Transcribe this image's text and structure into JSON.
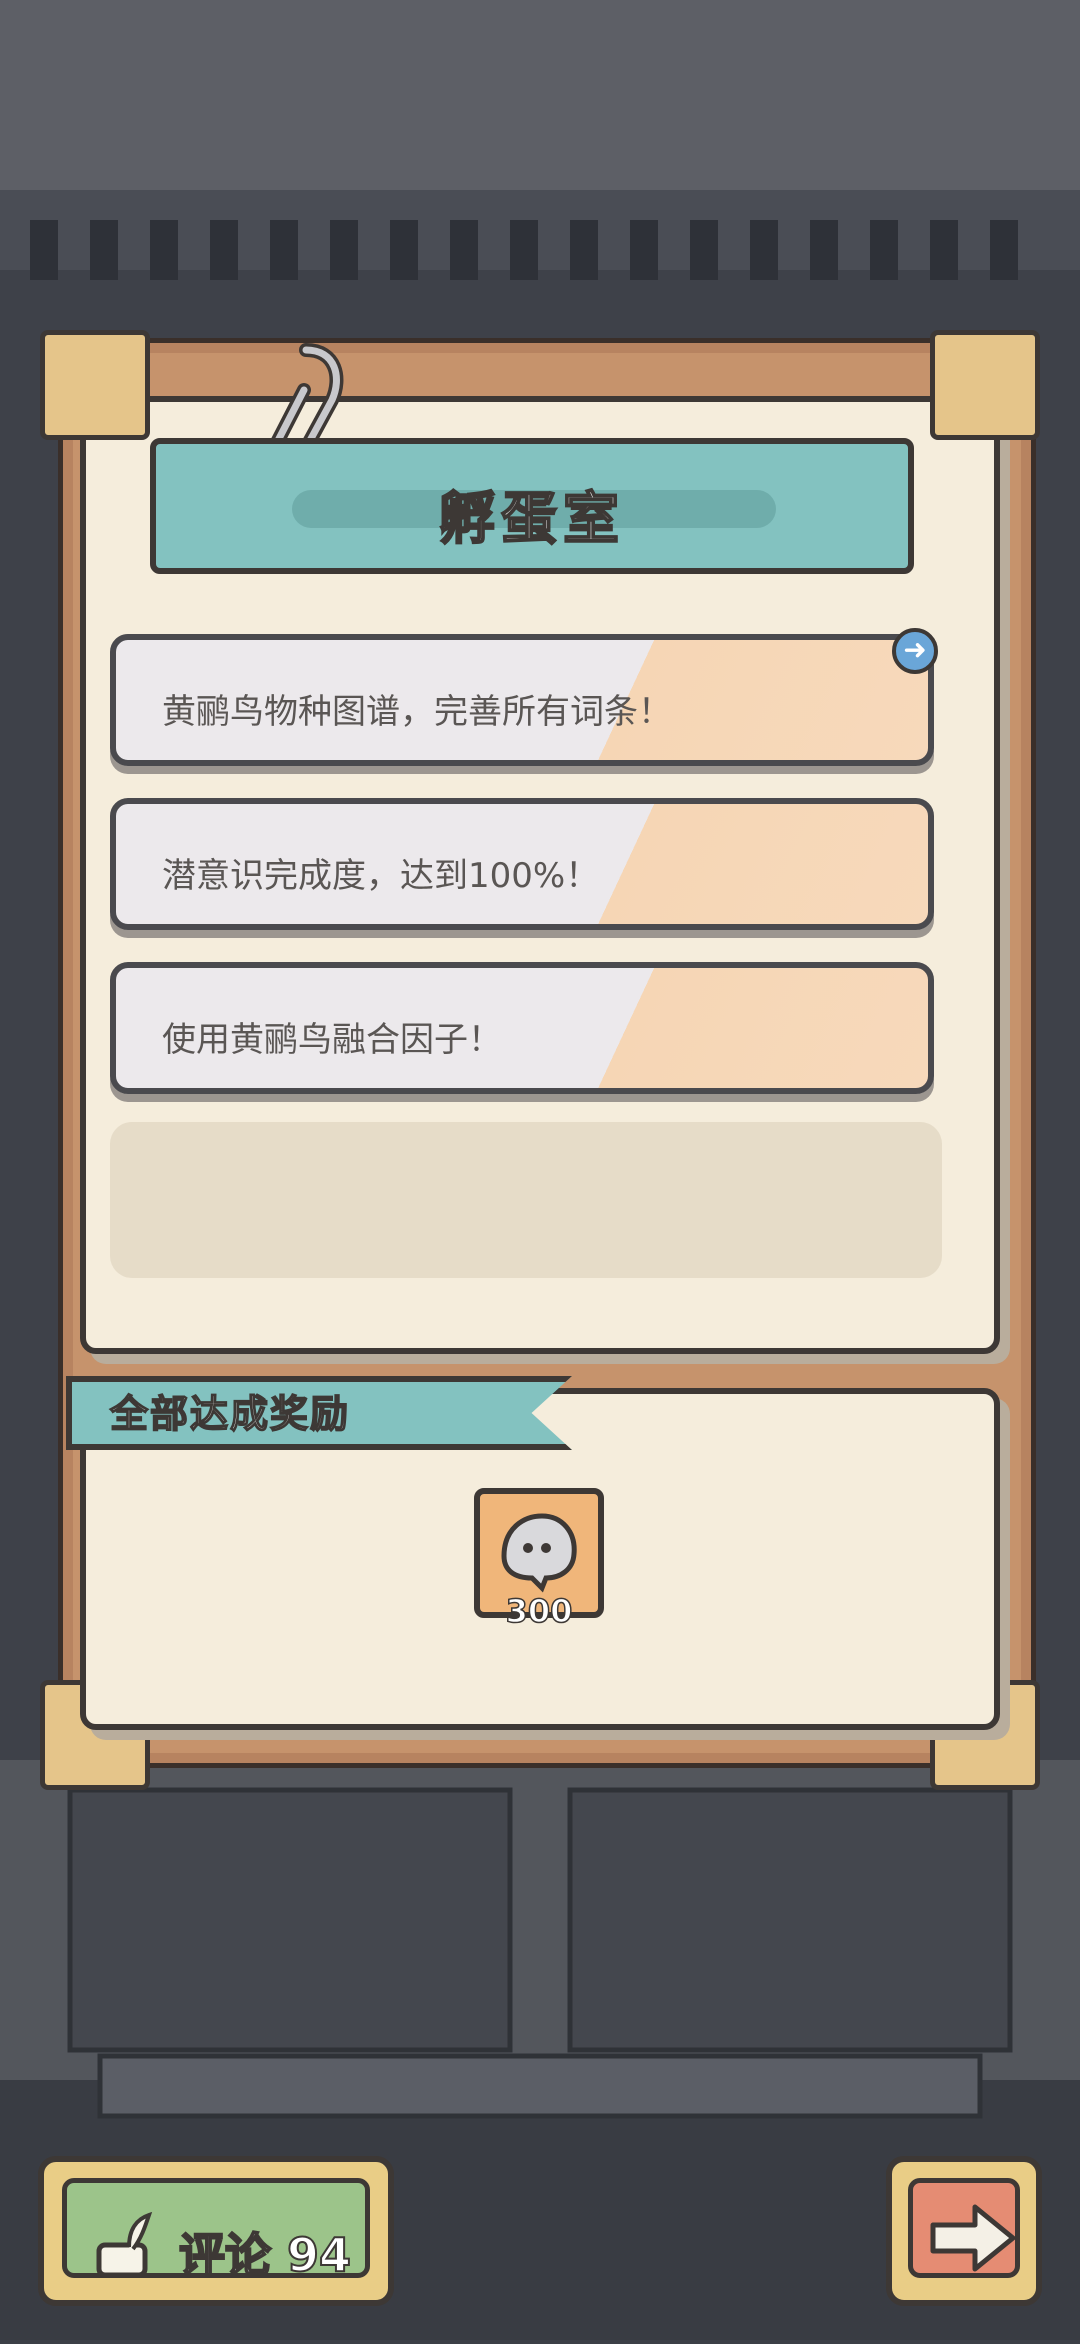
{
  "title": "孵蛋室",
  "tasks": [
    {
      "text": "黄鹂鸟物种图谱，完善所有词条！"
    },
    {
      "text": "潜意识完成度，达到100%！"
    },
    {
      "text": "使用黄鹂鸟融合因子！"
    }
  ],
  "reward": {
    "label": "全部达成奖励",
    "item_icon": "ghost-currency-icon",
    "count": "300"
  },
  "footer": {
    "comment_label": "评论 94",
    "next_icon": "arrow-right-icon"
  },
  "colors": {
    "accent_teal": "#83c2c0",
    "paper": "#f5eddc",
    "wood": "#c6936c",
    "reward_tile": "#f0b67a",
    "comment_green": "#9cc48a",
    "next_orange": "#e58c73"
  }
}
